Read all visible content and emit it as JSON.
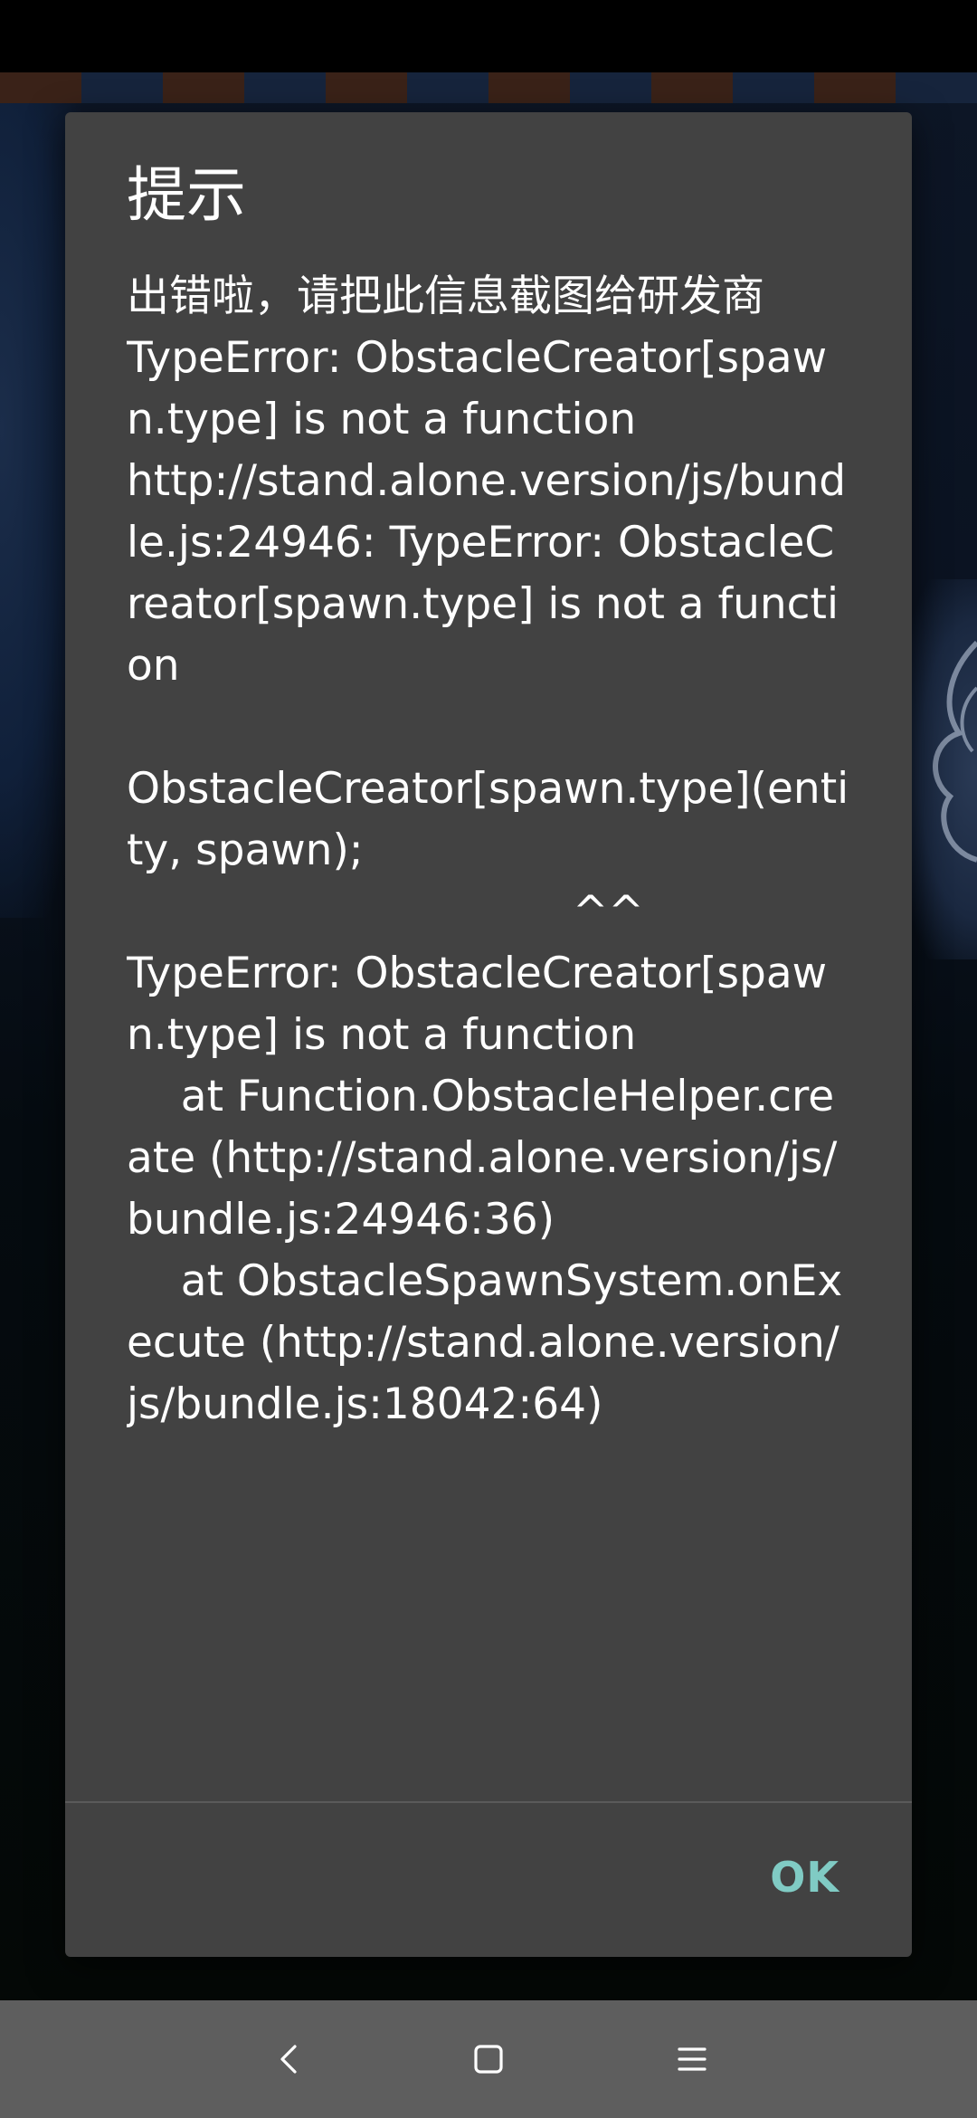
{
  "dialog": {
    "title": "提示",
    "message": "出错啦，请把此信息截图给研发商\nTypeError: ObstacleCreator[spawn.type] is not a function\nhttp://stand.alone.version/js/bundle.js:24946: TypeError: ObstacleCreator[spawn.type] is not a function\n\nObstacleCreator[spawn.type](entity, spawn);\n                                 ^^\nTypeError: ObstacleCreator[spawn.type] is not a function\n    at Function.ObstacleHelper.create (http://stand.alone.version/js/bundle.js:24946:36)\n    at ObstacleSpawnSystem.onExecute (http://stand.alone.version/js/bundle.js:18042:64)",
    "ok_label": "OK"
  },
  "navigation": {
    "back_icon": "chevron-left-icon",
    "home_icon": "square-home-icon",
    "menu_icon": "menu-lines-icon"
  },
  "colors": {
    "dialog_bg": "#424242",
    "accent": "#80cbc4",
    "nav_bar": "#5e5e5e"
  }
}
